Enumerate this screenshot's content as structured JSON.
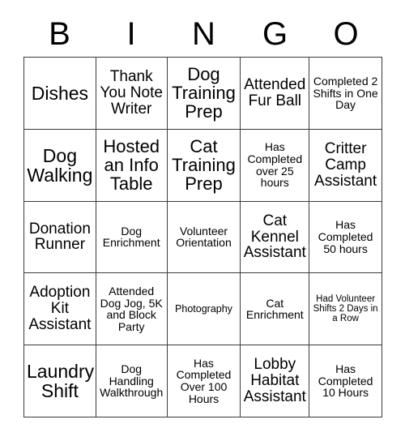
{
  "card": {
    "headers": [
      "B",
      "I",
      "N",
      "G",
      "O"
    ],
    "rows": [
      [
        {
          "text": "Dishes",
          "size": "t-xl"
        },
        {
          "text": "Thank You Note Writer",
          "size": "t-md"
        },
        {
          "text": "Dog Training Prep",
          "size": "t-lg"
        },
        {
          "text": "Attended Fur Ball",
          "size": "t-md"
        },
        {
          "text": "Completed 2 Shifts in One Day",
          "size": "t-sm"
        }
      ],
      [
        {
          "text": "Dog Walking",
          "size": "t-xl"
        },
        {
          "text": "Hosted an Info Table",
          "size": "t-lg"
        },
        {
          "text": "Cat Training Prep",
          "size": "t-lg"
        },
        {
          "text": "Has Completed over 25 hours",
          "size": "t-sm"
        },
        {
          "text": "Critter Camp Assistant",
          "size": "t-md"
        }
      ],
      [
        {
          "text": "Donation Runner",
          "size": "t-md"
        },
        {
          "text": "Dog Enrichment",
          "size": "t-sm"
        },
        {
          "text": "Volunteer Orientation",
          "size": "t-sm"
        },
        {
          "text": "Cat Kennel Assistant",
          "size": "t-md"
        },
        {
          "text": "Has Completed 50 hours",
          "size": "t-sm"
        }
      ],
      [
        {
          "text": "Adoption Kit Assistant",
          "size": "t-md"
        },
        {
          "text": "Attended Dog Jog, 5K and Block Party",
          "size": "t-sm"
        },
        {
          "text": "Photography",
          "size": "t-xs"
        },
        {
          "text": "Cat Enrichment",
          "size": "t-sm"
        },
        {
          "text": "Had Volunteer Shifts 2 Days in a Row",
          "size": "t-xxs"
        }
      ],
      [
        {
          "text": "Laundry Shift",
          "size": "t-xl"
        },
        {
          "text": "Dog Handling Walkthrough",
          "size": "t-sm"
        },
        {
          "text": "Has Completed Over 100 Hours",
          "size": "t-sm"
        },
        {
          "text": "Lobby Habitat Assistant",
          "size": "t-md"
        },
        {
          "text": "Has Completed 10 Hours",
          "size": "t-sm"
        }
      ]
    ]
  },
  "style": {
    "border_color": "#3a3a3a",
    "background": "#ffffff",
    "text_color": "#000000"
  }
}
